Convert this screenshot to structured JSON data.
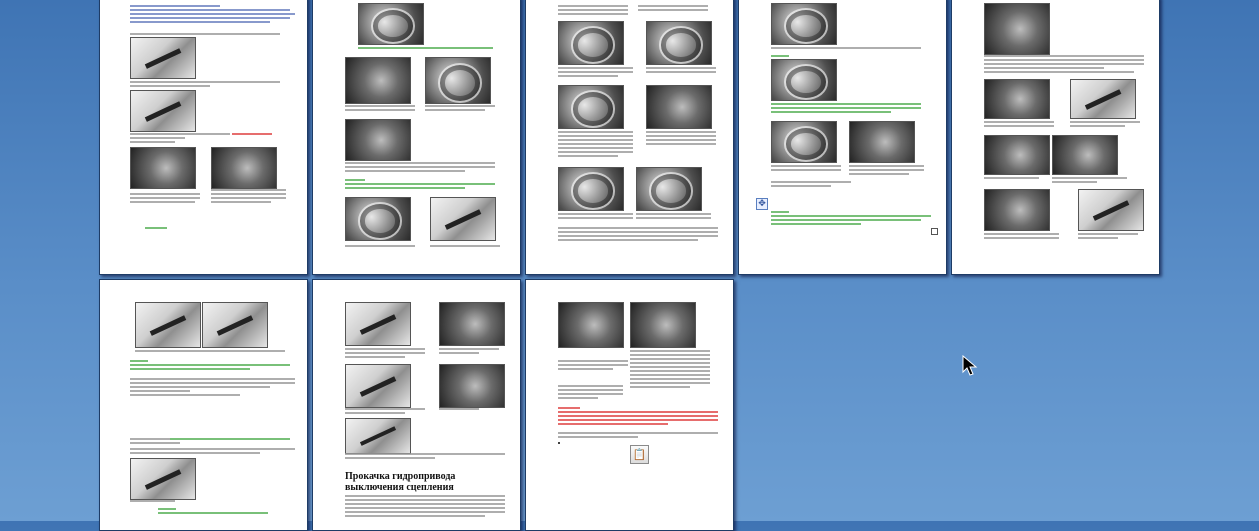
{
  "document": {
    "heading": "Прокачка гидропривода выключения сцепления",
    "page_count": 8
  },
  "icons": {
    "move_handle": "move-arrows-icon",
    "move_glyph": "✥",
    "paste_options": "paste-options-icon",
    "paste_glyph": "📋",
    "cursor": "mouse-pointer-icon"
  },
  "colors": {
    "background": "#4a80bf",
    "page": "#ffffff",
    "caption_green": "#2a8f2a",
    "warning_red": "#d21818",
    "link_blue": "#2a3f8f"
  }
}
